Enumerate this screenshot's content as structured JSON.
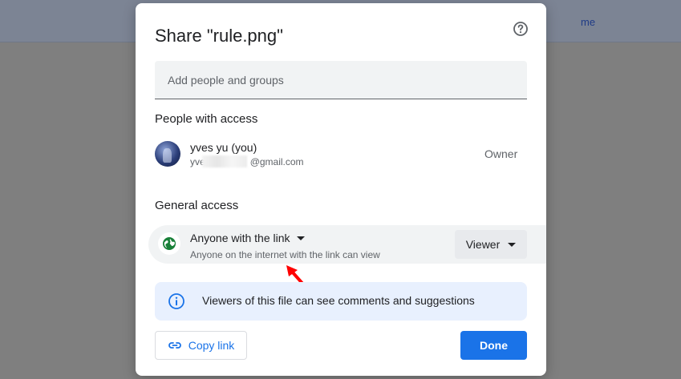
{
  "backdrop": {
    "header_text": "me"
  },
  "dialog": {
    "title": "Share \"rule.png\"",
    "add_people_placeholder": "Add people and groups",
    "people_heading": "People with access",
    "person": {
      "name": "yves yu (you)",
      "email_start": "yve",
      "email_end": "@gmail.com",
      "role": "Owner"
    },
    "general_heading": "General access",
    "general": {
      "access_label": "Anyone with the link",
      "access_description": "Anyone on the internet with the link can view",
      "role_label": "Viewer"
    },
    "info_banner_text": "Viewers of this file can see comments and suggestions",
    "copy_link_label": "Copy link",
    "done_label": "Done"
  },
  "colors": {
    "accent": "#1a73e8",
    "globe_green": "#188038",
    "annotation_red": "#ff0000",
    "info_bg": "#e8f0fe"
  },
  "icons": [
    "help-icon",
    "globe-icon",
    "dropdown-caret-icon",
    "info-icon",
    "link-icon",
    "arrow-annotation"
  ]
}
